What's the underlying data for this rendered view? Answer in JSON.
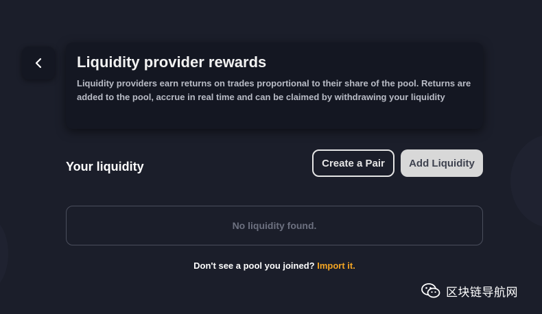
{
  "header": {
    "back_icon": "chevron-left-icon"
  },
  "info_card": {
    "title": "Liquidity provider rewards",
    "description": "Liquidity providers earn returns on trades proportional to their share of the pool. Returns are added to the pool, accrue in real time and can be claimed by withdrawing your liquidity"
  },
  "liquidity": {
    "section_title": "Your liquidity",
    "create_pair_label": "Create a Pair",
    "add_liquidity_label": "Add Liquidity",
    "empty_message": "No liquidity found."
  },
  "import": {
    "prompt": "Don't see a pool you joined?",
    "link_label": "Import it."
  },
  "watermark": {
    "text": "区块链导航网",
    "icon": "wechat-icon"
  },
  "colors": {
    "background": "#1b1e2a",
    "card": "#141722",
    "accent": "#f5a623",
    "primary_button": "#d8d8d8"
  }
}
